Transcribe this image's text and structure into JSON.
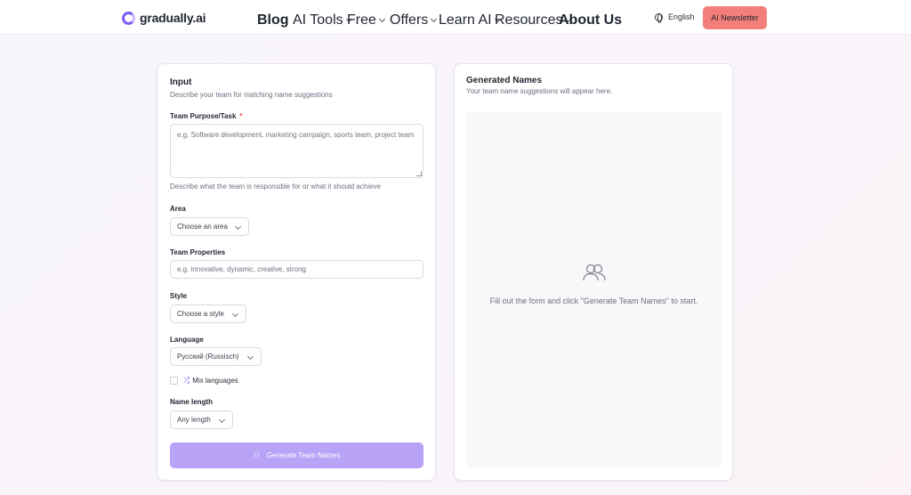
{
  "header": {
    "logo_text": "gradually.ai",
    "nav": [
      {
        "label": "Blog",
        "has_dropdown": false
      },
      {
        "label": "AI Tools",
        "has_dropdown": true
      },
      {
        "label": "Free",
        "has_dropdown": true
      },
      {
        "label": "Offers",
        "has_dropdown": true
      },
      {
        "label": "Learn AI",
        "has_dropdown": true
      },
      {
        "label": "Resources",
        "has_dropdown": true
      },
      {
        "label": "About Us",
        "has_dropdown": false
      }
    ],
    "language": "English",
    "newsletter_button": "AI Newsletter"
  },
  "input_card": {
    "title": "Input",
    "subtitle": "Describe your team for matching name suggestions",
    "purpose": {
      "label": "Team Purpose/Task",
      "required_mark": "*",
      "placeholder": "e.g. Software development, marketing campaign, sports team, project team",
      "hint": "Describe what the team is responsible for or what it should achieve"
    },
    "area": {
      "label": "Area",
      "value": "Choose an area"
    },
    "properties": {
      "label": "Team Properties",
      "placeholder": "e.g. innovative, dynamic, creative, strong"
    },
    "style": {
      "label": "Style",
      "value": "Choose a style"
    },
    "language": {
      "label": "Language",
      "value": "Русский (Russisch)"
    },
    "mix_languages": {
      "label": "Mix languages",
      "checked": false
    },
    "name_length": {
      "label": "Name length",
      "value": "Any length"
    },
    "generate_button": "Generate Team Names"
  },
  "output_card": {
    "title": "Generated Names",
    "subtitle": "Your team name suggestions will appear here.",
    "empty_message": "Fill out the form and click \"Generate Team Names\" to start."
  },
  "colors": {
    "accent": "#7c5cf0",
    "button_disabled": "#b8a3f6",
    "newsletter": "#f47f7a",
    "required": "#e5484d"
  }
}
